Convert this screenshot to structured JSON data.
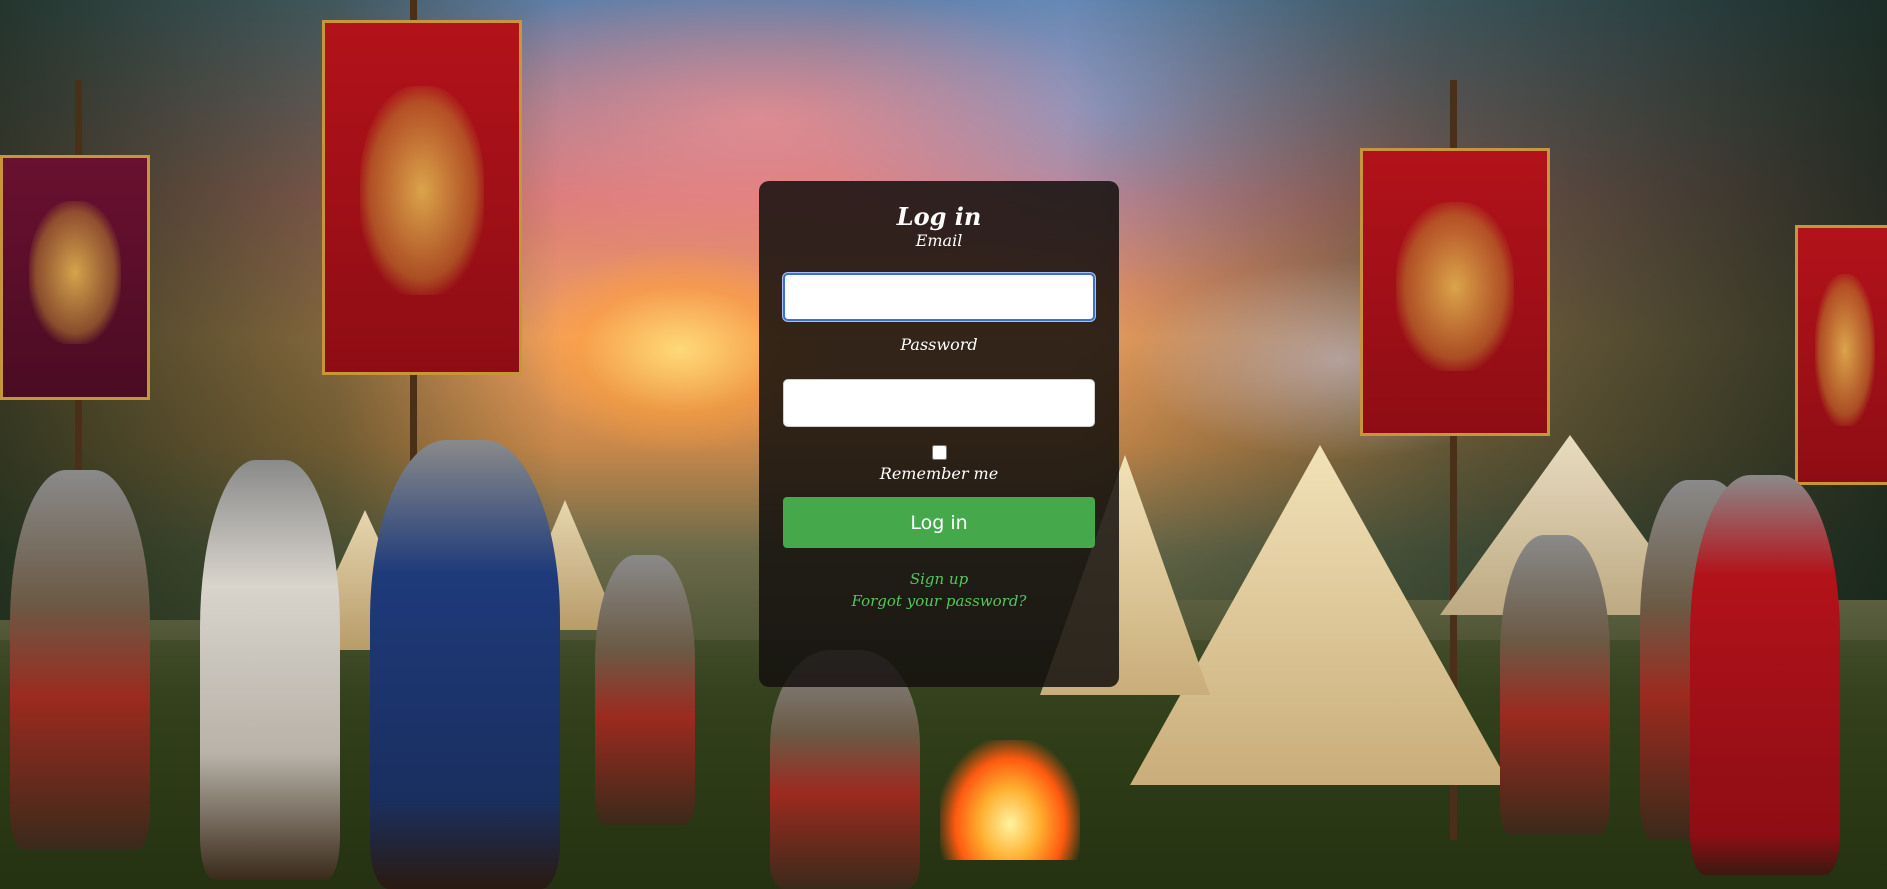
{
  "login": {
    "title": "Log in",
    "email_label": "Email",
    "email_value": "",
    "password_label": "Password",
    "password_value": "",
    "remember_label": "Remember me",
    "remember_checked": false,
    "submit_label": "Log in",
    "signup_label": "Sign up",
    "forgot_label": "Forgot your password?"
  },
  "colors": {
    "panel_background": "#14100e",
    "button": "#45a84a",
    "link": "#54c65a",
    "focus_border": "#3b6fd6"
  },
  "background": {
    "description_icon": "roman-camp-illustration"
  }
}
